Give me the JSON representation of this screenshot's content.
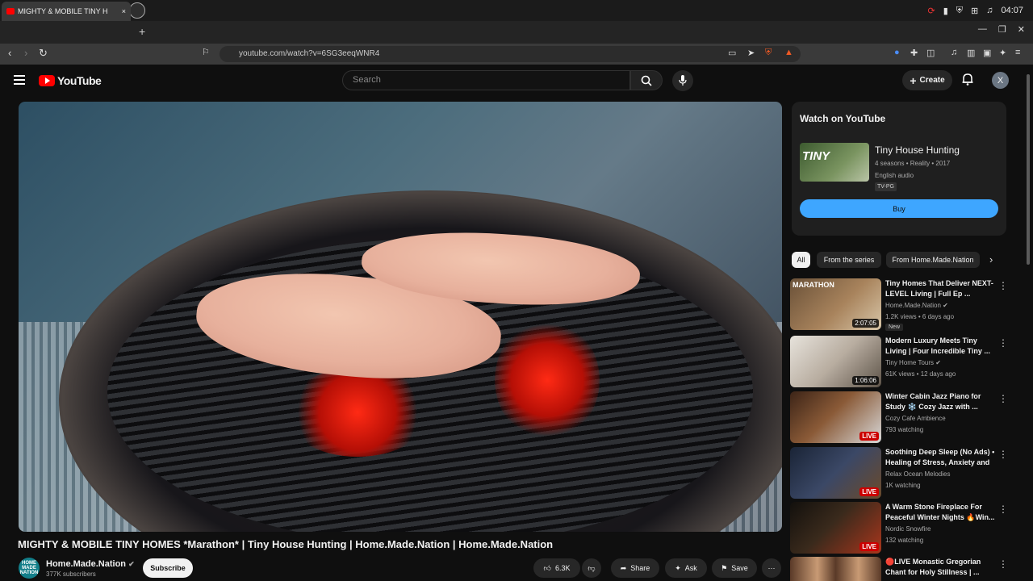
{
  "taskbar": {
    "clock": "04:07"
  },
  "browser": {
    "tab_title": "MIGHTY & MOBILE TINY H",
    "url": "youtube.com/watch?v=6SG3eeqWNR4",
    "new_tab": "+",
    "close": "×"
  },
  "youtube": {
    "logo": "YouTube",
    "search_placeholder": "Search",
    "create_label": "Create",
    "avatar_letter": "X"
  },
  "video": {
    "title": "MIGHTY & MOBILE TINY HOMES *Marathon* | Tiny House Hunting | Home.Made.Nation | Home.Made.Nation",
    "channel": "Home.Made.Nation",
    "channel_logo": "HOME MADE NATION",
    "subscribers": "377K subscribers",
    "subscribe_label": "Subscribe",
    "likes": "6.3K",
    "share_label": "Share",
    "ask_label": "Ask",
    "save_label": "Save"
  },
  "watch_card": {
    "heading": "Watch on YouTube",
    "show_title": "Tiny House Hunting",
    "thumb_text": "TINY",
    "meta": "4 seasons • Reality • 2017",
    "audio": "English audio",
    "rating": "TV-PG",
    "buy_label": "Buy"
  },
  "chips": [
    "All",
    "From the series",
    "From Home.Made.Nation"
  ],
  "recommendations": [
    {
      "title": "Tiny Homes That Deliver NEXT-LEVEL Living | Full Ep ...",
      "channel": "Home.Made.Nation",
      "views": "1.2K views • 6 days ago",
      "duration": "2:07:05",
      "badge": "New",
      "thumb_label": "MARATHON",
      "thumb_color": "#8a6a48"
    },
    {
      "title": "Modern Luxury Meets Tiny Living | Four Incredible Tiny ...",
      "channel": "Tiny Home Tours",
      "views": "61K views • 12 days ago",
      "duration": "1:06:06",
      "thumb_color": "#c7c2b8"
    },
    {
      "title": "Winter Cabin Jazz Piano for Study ❄️ Cozy Jazz with ...",
      "channel": "Cozy Cafe Ambience",
      "views": "793 watching",
      "live": "LIVE",
      "thumb_color": "#6a4a35"
    },
    {
      "title": "Soothing Deep Sleep (No Ads) • Healing of Stress, Anxiety and ...",
      "channel": "Relax Ocean Melodies",
      "views": "1K watching",
      "live": "LIVE",
      "thumb_color": "#2a3346"
    },
    {
      "title": "A Warm Stone Fireplace For Peaceful Winter Nights 🔥Win...",
      "channel": "Nordic Snowfire",
      "views": "132 watching",
      "live": "LIVE",
      "thumb_color": "#2b2018"
    },
    {
      "title": "🔴LIVE Monastic Gregorian Chant for Holy Stillness | ...",
      "channel": "",
      "views": "",
      "thumb_color": "#6d4b35"
    }
  ]
}
